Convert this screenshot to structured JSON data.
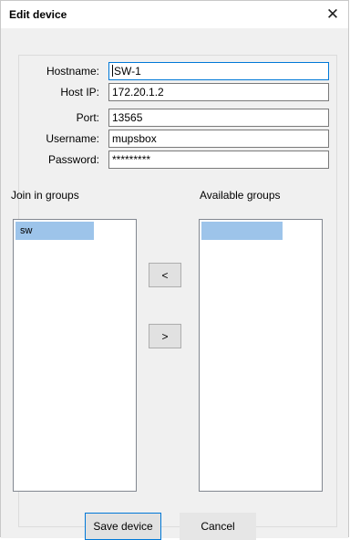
{
  "window": {
    "title": "Edit device",
    "close_glyph": "✕"
  },
  "form": {
    "hostname": {
      "label": "Hostname:",
      "value": "SW-1"
    },
    "host_ip": {
      "label": "Host IP:",
      "value": "172.20.1.2"
    },
    "port": {
      "label": "Port:",
      "value": "13565"
    },
    "username": {
      "label": "Username:",
      "value": "mupsbox"
    },
    "password": {
      "label": "Password:",
      "value": "*********"
    }
  },
  "groups": {
    "joined_label": "Join in groups",
    "available_label": "Available groups",
    "joined_items": [
      "sw"
    ],
    "available_items": [
      ""
    ],
    "move_left_label": "<",
    "move_right_label": ">"
  },
  "buttons": {
    "save_label": "Save device",
    "cancel_label": "Cancel"
  },
  "colors": {
    "selection": "#9dc4ea",
    "focus_border": "#0078d7",
    "dialog_bg": "#f0f0f0"
  }
}
